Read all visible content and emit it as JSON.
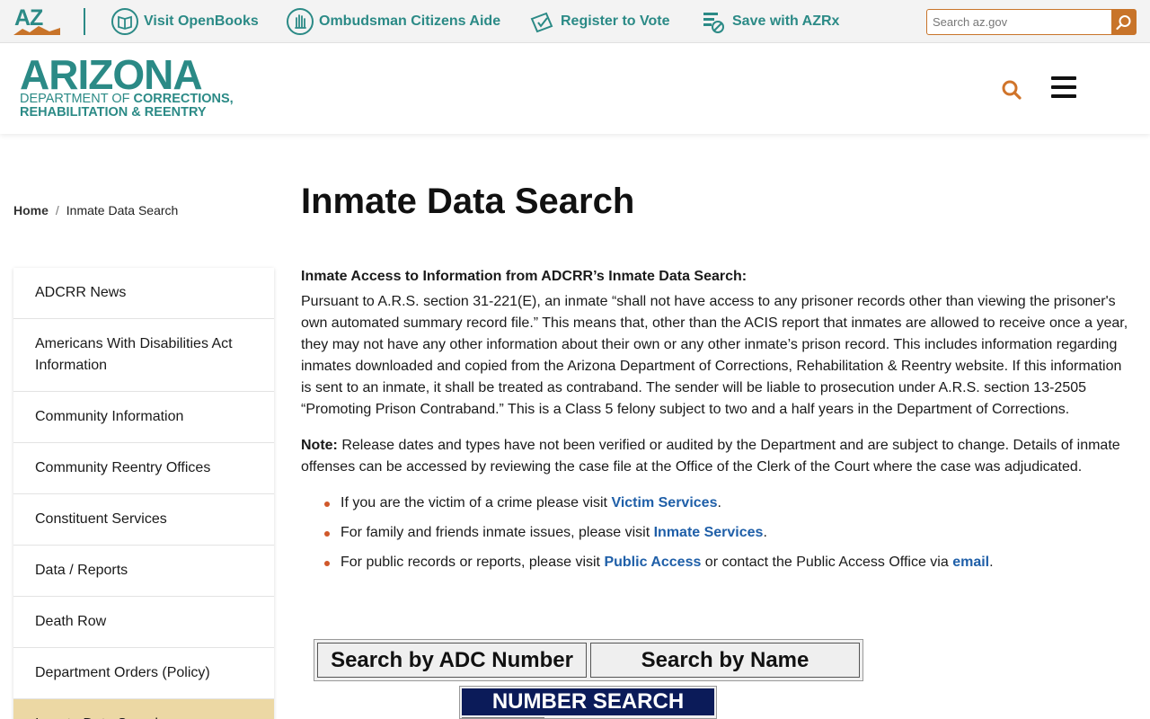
{
  "topbar": {
    "az_logo_text": "AZ",
    "links": [
      {
        "label": "Visit OpenBooks",
        "icon": "book-icon"
      },
      {
        "label": "Ombudsman Citizens Aide",
        "icon": "hand-icon"
      },
      {
        "label": "Register to Vote",
        "icon": "ballot-icon"
      },
      {
        "label": "Save with AZRx",
        "icon": "pill-icon"
      }
    ],
    "search_placeholder": "Search az.gov"
  },
  "header": {
    "logo_big": "ARIZONA",
    "logo_line1_a": "DEPARTMENT OF ",
    "logo_line1_b": "CORRECTIONS,",
    "logo_line2": "REHABILITATION & REENTRY"
  },
  "breadcrumb": {
    "home": "Home",
    "separator": "/",
    "current": "Inmate Data Search"
  },
  "sidebar": {
    "items": [
      {
        "label": "ADCRR News"
      },
      {
        "label": "Americans With Disabilities Act Information"
      },
      {
        "label": "Community Information"
      },
      {
        "label": "Community Reentry Offices"
      },
      {
        "label": "Constituent Services"
      },
      {
        "label": "Data / Reports"
      },
      {
        "label": "Death Row"
      },
      {
        "label": "Department Orders (Policy)"
      },
      {
        "label": "Inmate Data Search"
      }
    ]
  },
  "main": {
    "title": "Inmate Data Search",
    "lead": "Inmate Access to Information from ADCRR’s Inmate Data Search:",
    "paragraph1": "Pursuant to A.R.S. section 31-221(E), an inmate “shall not have access to any prisoner records other than viewing the prisoner's own automated summary record file.” This means that, other than the ACIS report that inmates are allowed to receive once a year, they may not have any other information about their own or any other inmate’s prison record. This includes information regarding inmates downloaded and copied from the Arizona Department of Corrections, Rehabilitation & Reentry website. If this information is sent to an inmate, it shall be treated as contraband. The sender will be liable to prosecution under A.R.S. section 13-2505 “Promoting Prison Contraband.” This is a Class 5 felony subject to two and a half years in the Department of Corrections.",
    "note_label": "Note:",
    "note_text": " Release dates and types have not been verified or audited by the Department and are subject to change. Details of inmate offenses can be accessed by reviewing the case file at the Office of the Clerk of the Court where the case was adjudicated.",
    "bullets": {
      "b1_text": "If you are the victim of a crime please visit ",
      "b1_link": "Victim Services",
      "b1_end": ".",
      "b2_text": "For family and friends inmate issues, please visit ",
      "b2_link": "Inmate Services",
      "b2_end": ".",
      "b3_text": "For public records or reports, please visit ",
      "b3_link": "Public Access",
      "b3_mid": " or contact the Public Access Office via ",
      "b3_link2": "email",
      "b3_end": "."
    }
  },
  "search_widget": {
    "by_number": "Search by ADC Number",
    "by_name": "Search by Name",
    "number_banner": "NUMBER SEARCH"
  },
  "colors": {
    "teal": "#2b8a86",
    "orange": "#c8742a",
    "link": "#1f5fa8",
    "active_bg": "#ecd8a4",
    "banner": "#0b1b59"
  }
}
